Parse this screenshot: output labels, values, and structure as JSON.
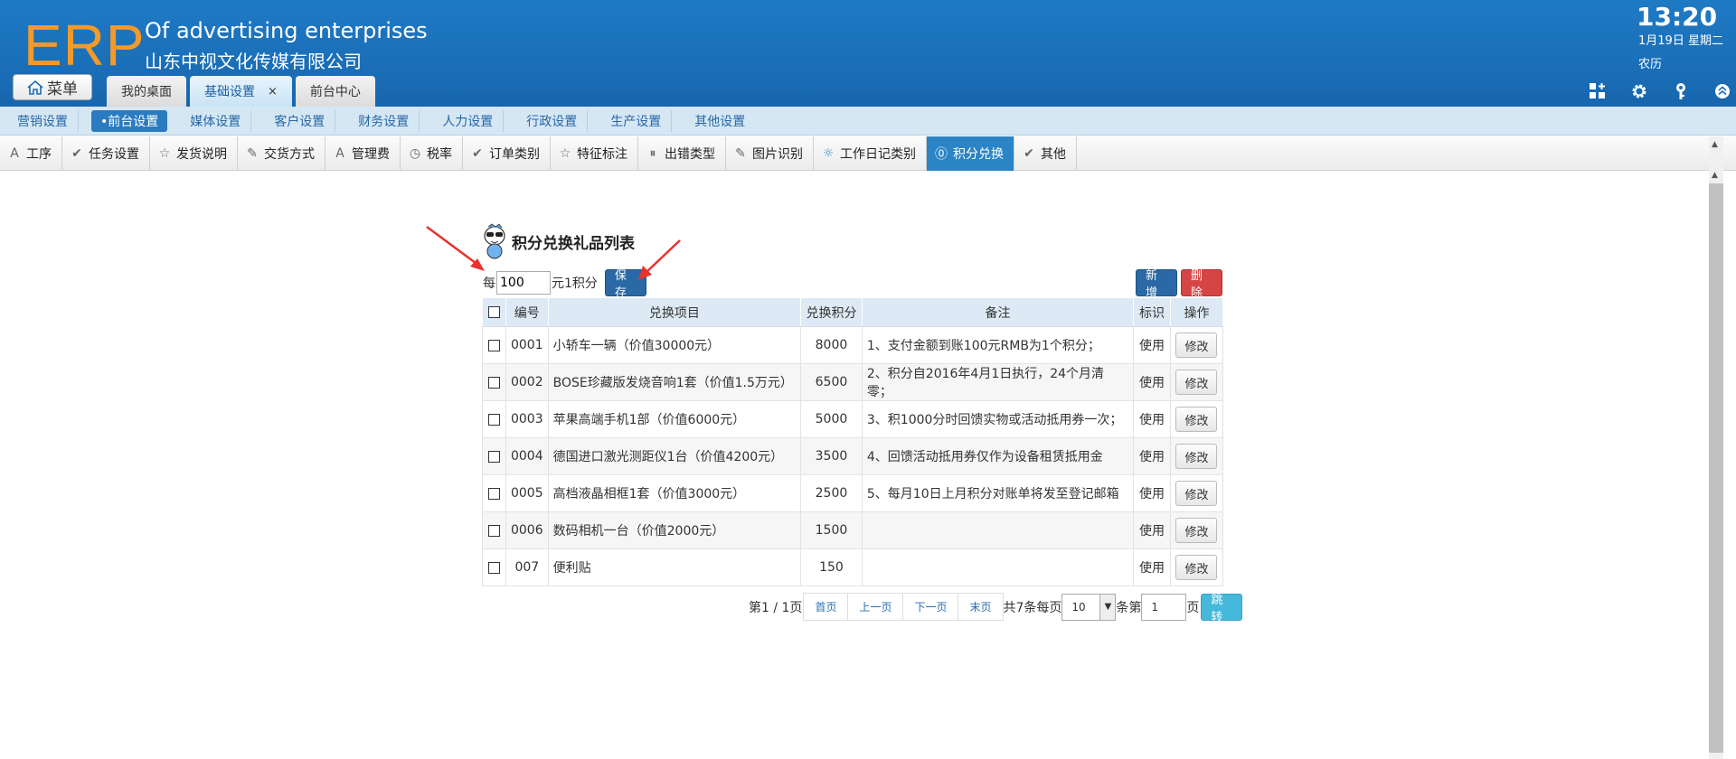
{
  "header": {
    "logo": "ERP",
    "company_en": "Of advertising enterprises",
    "company_cn": "山东中视文化传媒有限公司",
    "time": "13:20",
    "date": "1月19日 星期二",
    "lunar": "农历",
    "menu_label": "菜单",
    "tabs": [
      {
        "label": "我的桌面"
      },
      {
        "label": "基础设置",
        "close": "×"
      },
      {
        "label": "前台中心"
      }
    ],
    "icons": [
      "grid-add-icon",
      "gear-icon",
      "key-icon",
      "chevron-up-circle-icon"
    ]
  },
  "nav2": [
    "营销设置",
    "•前台设置",
    "媒体设置",
    "客户设置",
    "财务设置",
    "人力设置",
    "行政设置",
    "生产设置",
    "其他设置"
  ],
  "nav3": [
    {
      "icon": "A",
      "label": "工序"
    },
    {
      "icon": "✔",
      "label": "任务设置"
    },
    {
      "icon": "☆",
      "label": "发货说明"
    },
    {
      "icon": "✎",
      "label": "交货方式"
    },
    {
      "icon": "A",
      "label": "管理费"
    },
    {
      "icon": "◷",
      "label": "税率"
    },
    {
      "icon": "✔",
      "label": "订单类别"
    },
    {
      "icon": "☆",
      "label": "特征标注"
    },
    {
      "icon": "⏸",
      "label": "出错类型"
    },
    {
      "icon": "✎",
      "label": "图片识别"
    },
    {
      "icon": "☼",
      "label": "工作日记类别"
    },
    {
      "icon": "⓪",
      "label": "积分兑换"
    },
    {
      "icon": "✔",
      "label": "其他"
    }
  ],
  "main": {
    "title": "积分兑换礼品列表",
    "rate_prefix": "每",
    "rate_value": "100",
    "rate_suffix": "元1积分",
    "save": "保存",
    "add": "新增",
    "delete": "删除",
    "columns": [
      "编号",
      "兑换项目",
      "兑换积分",
      "备注",
      "标识",
      "操作"
    ],
    "rows": [
      {
        "id": "0001",
        "item": "小轿车一辆（价值30000元）",
        "points": "8000",
        "note": "1、支付金额到账100元RMB为1个积分；",
        "flag": "使用",
        "action": "修改"
      },
      {
        "id": "0002",
        "item": "BOSE珍藏版发烧音响1套（价值1.5万元）",
        "points": "6500",
        "note": "2、积分自2016年4月1日执行，24个月清零；",
        "flag": "使用",
        "action": "修改"
      },
      {
        "id": "0003",
        "item": "苹果高端手机1部（价值6000元）",
        "points": "5000",
        "note": "3、积1000分时回馈实物或活动抵用券一次；",
        "flag": "使用",
        "action": "修改"
      },
      {
        "id": "0004",
        "item": "德国进口激光测距仪1台（价值4200元）",
        "points": "3500",
        "note": "4、回馈活动抵用券仅作为设备租赁抵用金",
        "flag": "使用",
        "action": "修改"
      },
      {
        "id": "0005",
        "item": "高档液晶相框1套（价值3000元）",
        "points": "2500",
        "note": "5、每月10日上月积分对账单将发至登记邮箱",
        "flag": "使用",
        "action": "修改"
      },
      {
        "id": "0006",
        "item": "数码相机一台（价值2000元）",
        "points": "1500",
        "note": "",
        "flag": "使用",
        "action": "修改"
      },
      {
        "id": "007",
        "item": "便利贴",
        "points": "150",
        "note": "",
        "flag": "使用",
        "action": "修改"
      }
    ],
    "pager": {
      "page_info": "第1 / 1页",
      "first": "首页",
      "prev": "上一页",
      "next": "下一页",
      "last": "末页",
      "total_prefix": "共7条每页",
      "page_size": "10",
      "goto_prefix": "条第",
      "goto_value": "1",
      "goto_suffix": "页",
      "jump": "跳转"
    }
  }
}
